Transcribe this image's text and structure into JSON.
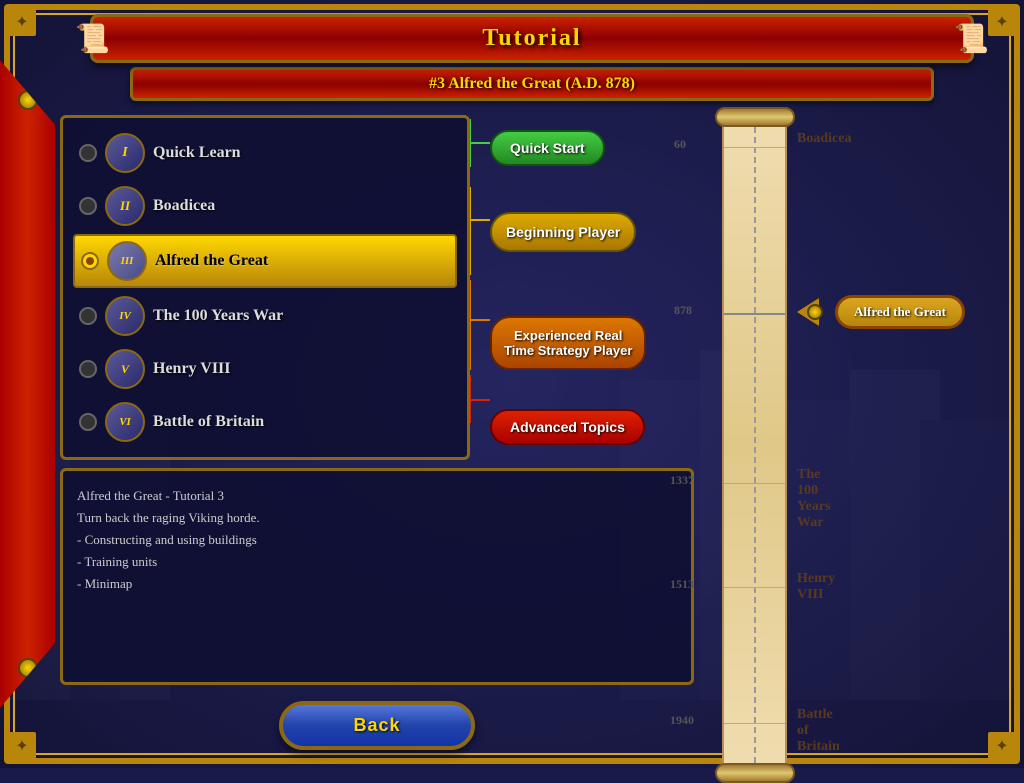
{
  "title": "Tutorial",
  "subtitle": "#3 Alfred the Great (A.D. 878)",
  "tutorials": [
    {
      "id": 1,
      "roman": "I",
      "name": "Quick Learn",
      "active": false
    },
    {
      "id": 2,
      "roman": "II",
      "name": "Boadicea",
      "active": false
    },
    {
      "id": 3,
      "roman": "III",
      "name": "Alfred the Great",
      "active": true
    },
    {
      "id": 4,
      "roman": "IV",
      "name": "The 100 Years War",
      "active": false
    },
    {
      "id": 5,
      "roman": "V",
      "name": "Henry VIII",
      "active": false
    },
    {
      "id": 6,
      "roman": "VI",
      "name": "Battle of Britain",
      "active": false
    }
  ],
  "difficulty_groups": [
    {
      "label": "Quick Start",
      "color": "green",
      "rows": [
        1
      ]
    },
    {
      "label": "Beginning Player",
      "color": "yellow",
      "rows": [
        2,
        3
      ]
    },
    {
      "label": "Experienced Real Time Strategy Player",
      "color": "orange",
      "rows": [
        4,
        5
      ]
    },
    {
      "label": "Advanced Topics",
      "color": "red",
      "rows": [
        6
      ]
    }
  ],
  "description": "Alfred the Great - Tutorial 3\nTurn back the raging Viking horde.\n- Constructing and using buildings\n- Training units\n- Minimap",
  "back_button": "Back",
  "timeline": {
    "markers": [
      {
        "year": "60",
        "name": "Boadicea",
        "top_pct": 5
      },
      {
        "year": "878",
        "name": "Alfred the Great",
        "top_pct": 30,
        "active": true
      },
      {
        "year": "1337",
        "name": "The 100 Years War",
        "top_pct": 56
      },
      {
        "year": "1513",
        "name": "Henry VIII",
        "top_pct": 72
      },
      {
        "year": "1940",
        "name": "Battle of Britain",
        "top_pct": 92
      }
    ],
    "active_label": "Alfred the Great"
  }
}
